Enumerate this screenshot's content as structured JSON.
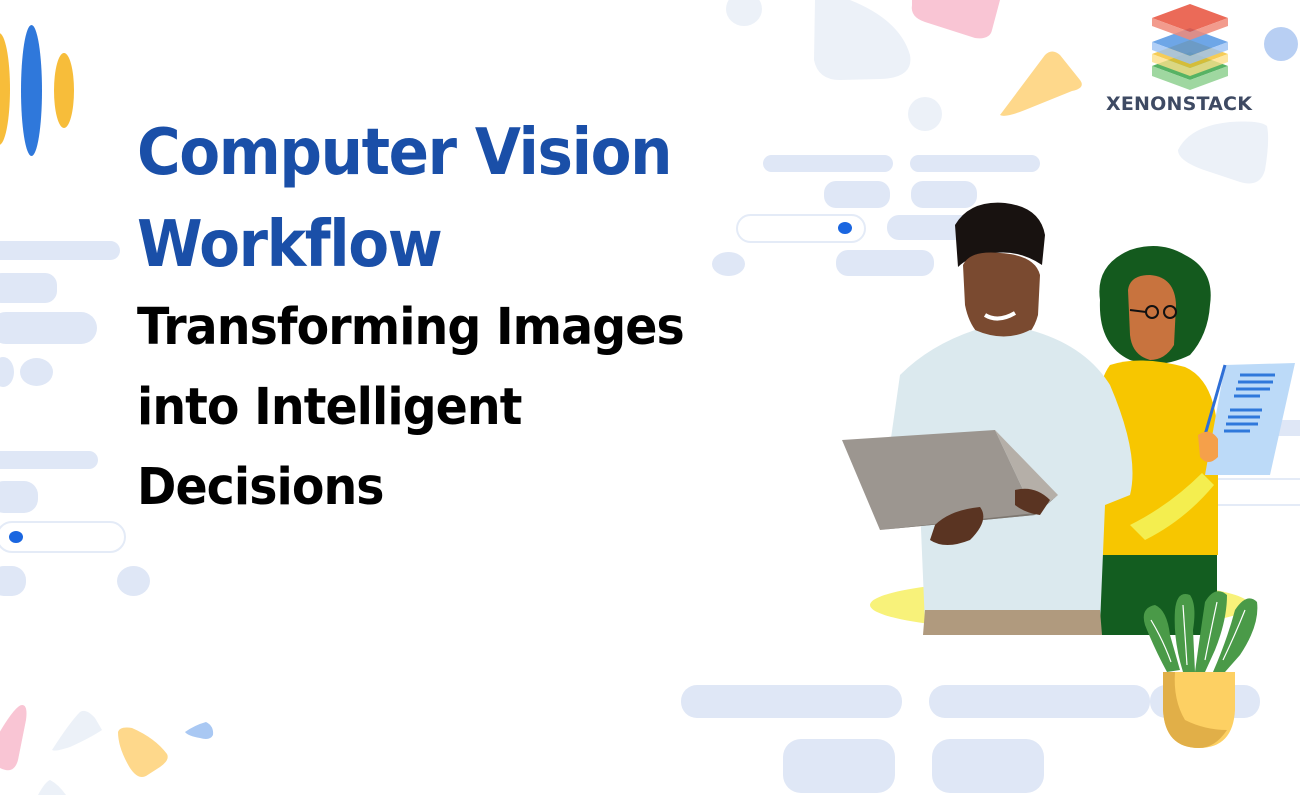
{
  "banner": {
    "title_lines": [
      "Computer Vision",
      "Workflow"
    ],
    "subtitle_lines": [
      "Transforming Images",
      "into Intelligent",
      "Decisions"
    ],
    "title_color": "#1a4fa8",
    "subtitle_color": "#000000"
  },
  "logo": {
    "text": "XENONSTACK",
    "layer_colors": [
      "#e8513c",
      "#4a90e2",
      "#f5c02e",
      "#3aa64a"
    ]
  },
  "illustration": {
    "description": "Man holding laptop, illustrated woman with tablet, potted plant",
    "colors": {
      "accent_blue": "#2f6fd6",
      "accent_yellow": "#f7bd3a",
      "pale_blue": "#dfe7f6",
      "pink": "#f9c5d4",
      "plant_green": "#4a9a48",
      "pot_yellow": "#fdd063"
    }
  }
}
